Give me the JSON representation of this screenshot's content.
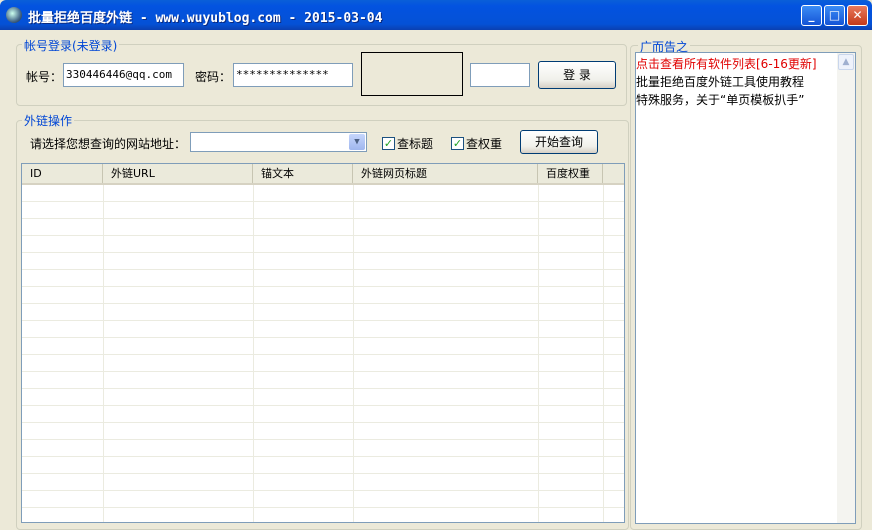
{
  "window": {
    "title": "批量拒绝百度外链 - www.wuyublog.com - 2015-03-04",
    "min": "_",
    "max": "□",
    "close": "✕"
  },
  "login": {
    "legend": "帐号登录(未登录)",
    "account_label": "帐号：",
    "account_value": "330446446@qq.com",
    "password_label": "密码：",
    "password_value": "**************",
    "captcha_value": "",
    "login_button": "登 录"
  },
  "ops": {
    "legend": "外链操作",
    "site_label": "请选择您想查询的网站地址：",
    "site_value": "",
    "check_title": "查标题",
    "check_weight": "查权重",
    "start_button": "开始查询"
  },
  "table": {
    "columns": [
      "ID",
      "外链URL",
      "锚文本",
      "外链网页标题",
      "百度权重"
    ],
    "rows": []
  },
  "ads": {
    "legend": "广而告之",
    "items": [
      {
        "text": "点击查看所有软件列表[6-16更新]",
        "color": "#e00000"
      },
      {
        "text": "批量拒绝百度外链工具使用教程",
        "color": "#000000"
      },
      {
        "text": "特殊服务，关于“单页模板扒手”",
        "color": "#000000"
      }
    ]
  }
}
